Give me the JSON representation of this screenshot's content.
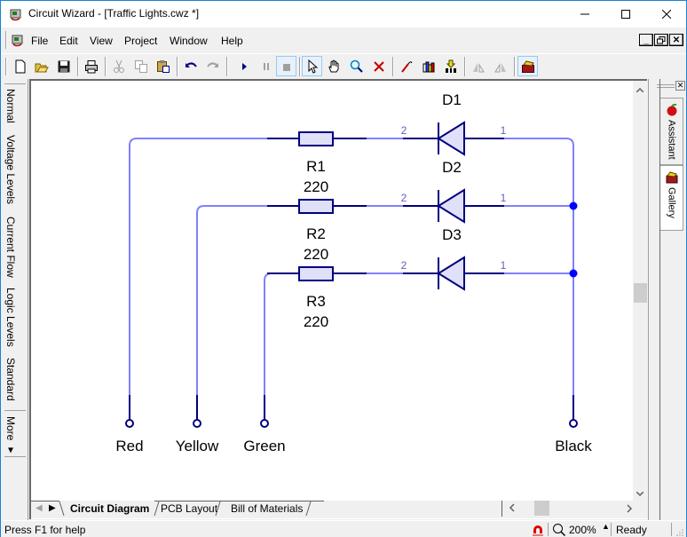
{
  "window": {
    "title": "Circuit Wizard - [Traffic Lights.cwz *]",
    "controls": [
      "minimize",
      "maximize",
      "close"
    ]
  },
  "menu": {
    "items": [
      "File",
      "Edit",
      "View",
      "Project",
      "Window",
      "Help"
    ],
    "mdi_controls": [
      "_",
      "🗗",
      "X"
    ]
  },
  "toolbar": {
    "buttons": [
      {
        "name": "new",
        "icon": "new-document-icon",
        "enabled": true
      },
      {
        "name": "open",
        "icon": "open-folder-icon",
        "enabled": true
      },
      {
        "name": "save",
        "icon": "save-icon",
        "enabled": true
      },
      {
        "name": "print",
        "icon": "print-icon",
        "enabled": true
      },
      {
        "name": "cut",
        "icon": "cut-icon",
        "enabled": false
      },
      {
        "name": "copy",
        "icon": "copy-icon",
        "enabled": false
      },
      {
        "name": "paste",
        "icon": "paste-icon",
        "enabled": true
      },
      {
        "name": "undo",
        "icon": "undo-icon",
        "enabled": true
      },
      {
        "name": "redo",
        "icon": "redo-icon",
        "enabled": false
      },
      {
        "name": "run",
        "icon": "play-icon",
        "enabled": true
      },
      {
        "name": "pause",
        "icon": "pause-icon",
        "enabled": false
      },
      {
        "name": "stop",
        "icon": "stop-icon",
        "enabled": false,
        "pressed": true
      },
      {
        "name": "select",
        "icon": "pointer-icon",
        "enabled": true,
        "pressed": true
      },
      {
        "name": "pan",
        "icon": "hand-icon",
        "enabled": true
      },
      {
        "name": "zoom",
        "icon": "magnifier-icon",
        "enabled": true
      },
      {
        "name": "delete",
        "icon": "delete-x-icon",
        "enabled": true
      },
      {
        "name": "probe",
        "icon": "probe-icon",
        "enabled": true
      },
      {
        "name": "graph",
        "icon": "bar-graph-icon",
        "enabled": true
      },
      {
        "name": "convert",
        "icon": "convert-to-pcb-icon",
        "enabled": true
      },
      {
        "name": "flip-left",
        "icon": "flip-left-icon",
        "enabled": false
      },
      {
        "name": "flip-right",
        "icon": "flip-right-icon",
        "enabled": false
      },
      {
        "name": "gallery",
        "icon": "toolbox-icon",
        "enabled": true,
        "pressed": true
      }
    ]
  },
  "mode_tabs": [
    "Normal",
    "Voltage Levels",
    "Current Flow",
    "Logic Levels",
    "Standard"
  ],
  "more_tab": "More ▾",
  "circuit": {
    "components": [
      {
        "ref": "R1",
        "value": "220",
        "type": "resistor"
      },
      {
        "ref": "R2",
        "value": "220",
        "type": "resistor"
      },
      {
        "ref": "R3",
        "value": "220",
        "type": "resistor"
      },
      {
        "ref": "D1",
        "type": "diode",
        "pin_left": "2",
        "pin_right": "1"
      },
      {
        "ref": "D2",
        "type": "diode",
        "pin_left": "2",
        "pin_right": "1"
      },
      {
        "ref": "D3",
        "type": "diode",
        "pin_left": "2",
        "pin_right": "1"
      }
    ],
    "terminals": [
      "Red",
      "Yellow",
      "Green",
      "Black"
    ],
    "colors": {
      "wire": "#8080ff",
      "component": "#000080",
      "component_fill": "#e0e0f8",
      "junction": "#0000ff",
      "pin_label": "#6060c0"
    }
  },
  "sheet_tabs": [
    "Circuit Diagram",
    "PCB Layout",
    "Bill of Materials"
  ],
  "active_sheet": "Circuit Diagram",
  "side_panel": {
    "tabs": [
      {
        "label": "Assistant",
        "icon": "apple-icon"
      },
      {
        "label": "Gallery",
        "icon": "toolbox-icon"
      }
    ]
  },
  "status": {
    "help": "Press F1 for help",
    "zoom": "200%",
    "state": "Ready"
  }
}
